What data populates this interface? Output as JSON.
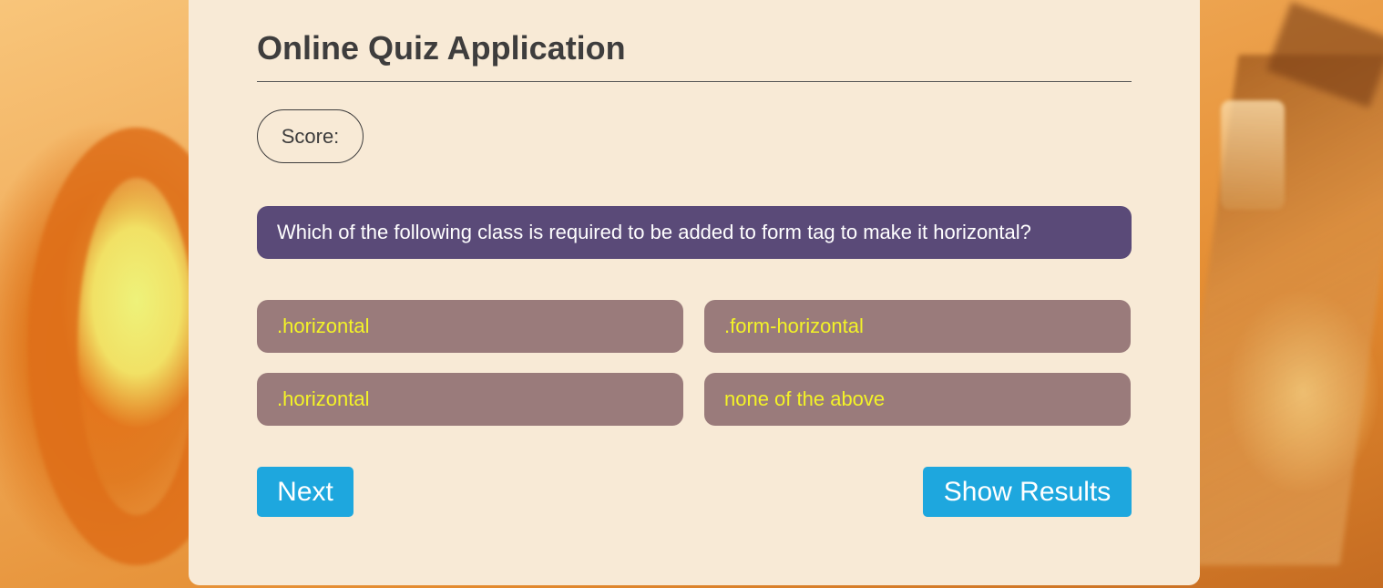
{
  "app": {
    "title": "Online Quiz Application"
  },
  "score": {
    "label": "Score:"
  },
  "question": {
    "text": "Which of the following class is required to be added to form tag to make it horizontal?"
  },
  "options": [
    {
      "label": ".horizontal"
    },
    {
      "label": ".form-horizontal"
    },
    {
      "label": ".horizontal"
    },
    {
      "label": "none of the above"
    }
  ],
  "buttons": {
    "next_label": "Next",
    "show_results_label": "Show Results"
  },
  "colors": {
    "panel_background": "#f8ead6",
    "question_background": "#5a4a78",
    "option_background": "#9a7b7b",
    "option_text": "#f3f327",
    "button_background": "#1ea7de",
    "heading_text": "#3e3d3d"
  }
}
